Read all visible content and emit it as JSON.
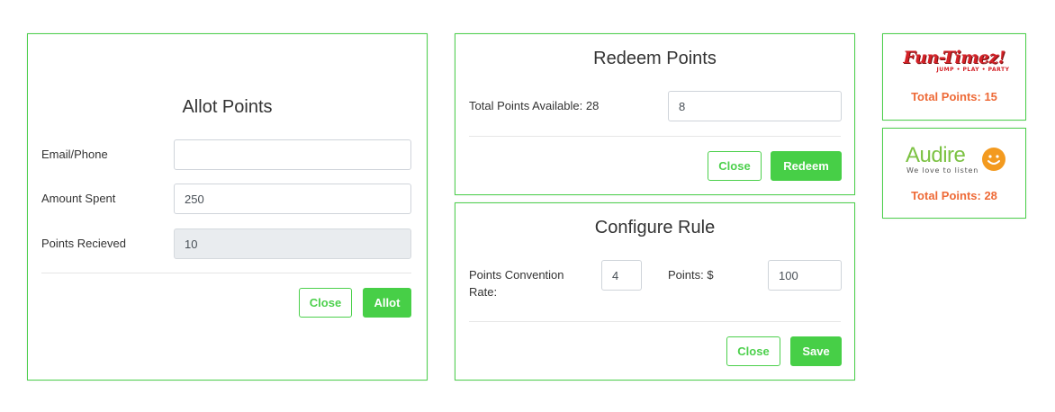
{
  "allot": {
    "title": "Allot Points",
    "email_label": "Email/Phone",
    "email_value": "",
    "amount_label": "Amount Spent",
    "amount_value": "250",
    "points_label": "Points Recieved",
    "points_value": "10",
    "close_label": "Close",
    "allot_label": "Allot"
  },
  "redeem": {
    "title": "Redeem Points",
    "available_label": "Total Points Available: 28",
    "redeem_value": "8",
    "close_label": "Close",
    "redeem_label": "Redeem"
  },
  "configure": {
    "title": "Configure Rule",
    "rate_label": "Points Convention Rate:",
    "rate_value": "4",
    "dollars_label": "Points: $",
    "dollars_value": "100",
    "close_label": "Close",
    "save_label": "Save"
  },
  "brands": [
    {
      "logo_text": "Fun-Timez!",
      "logo_tagline": "JUMP • PLAY • PARTY",
      "total_label": "Total Points: 15"
    },
    {
      "logo_text": "Audire",
      "logo_tagline": "We love to listen",
      "total_label": "Total Points: 28"
    }
  ],
  "colors": {
    "accent_green": "#47cf47",
    "border_green": "#4cd04c",
    "points_orange": "#ee6a37",
    "funtimez_red": "#d42127",
    "audire_green": "#7cc243",
    "audire_orange": "#f39a1f"
  }
}
